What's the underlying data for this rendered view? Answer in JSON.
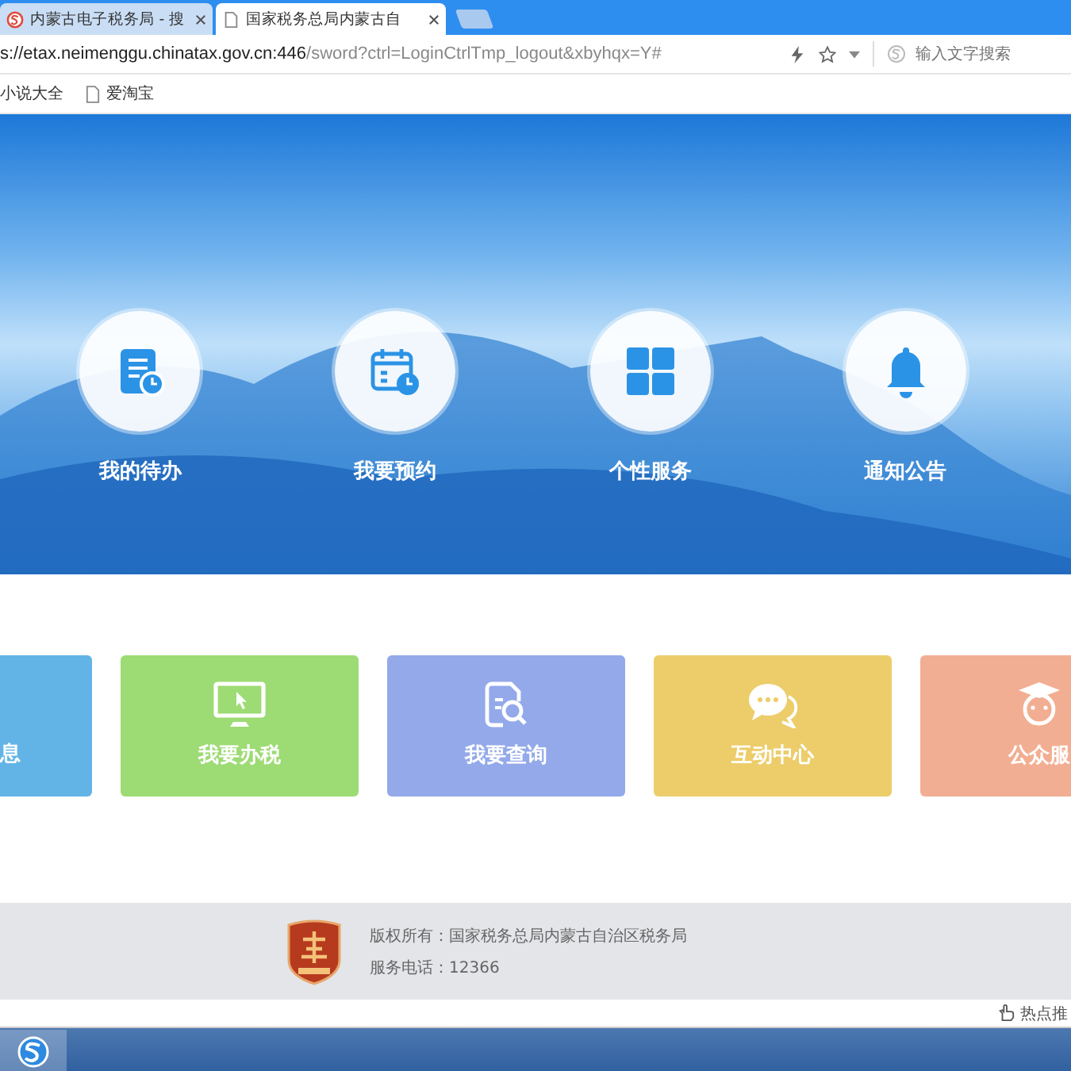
{
  "tabs": [
    {
      "title": "内蒙古电子税务局 - 搜",
      "selected": false
    },
    {
      "title": "国家税务总局内蒙古自",
      "selected": true
    }
  ],
  "address_bar": {
    "url_host": "s://etax.neimenggu.chinatax.gov.cn:446",
    "url_path": "/sword?ctrl=LoginCtrlTmp_logout&xbyhqx=Y#",
    "search_placeholder": "输入文字搜索"
  },
  "bookmarks": [
    "小说大全",
    "爱淘宝"
  ],
  "hero_items": [
    {
      "label": "我的待办",
      "kind": "todo"
    },
    {
      "label": "我要预约",
      "kind": "calendar"
    },
    {
      "label": "个性服务",
      "kind": "grid"
    },
    {
      "label": "通知公告",
      "kind": "bell"
    }
  ],
  "cards": [
    {
      "label": "息",
      "kind": "none",
      "color": "#62b4e6"
    },
    {
      "label": "我要办税",
      "kind": "monitor",
      "color": "#9ddb74"
    },
    {
      "label": "我要查询",
      "kind": "search",
      "color": "#93a9ea"
    },
    {
      "label": "互动中心",
      "kind": "chat",
      "color": "#eccd6a"
    },
    {
      "label": "公众服",
      "kind": "student",
      "color": "#f2ae92"
    }
  ],
  "footer": {
    "copyright": "版权所有：国家税务总局内蒙古自治区税务局",
    "phone": "服务电话：12366"
  },
  "status_bar": {
    "hot": "热点推"
  }
}
